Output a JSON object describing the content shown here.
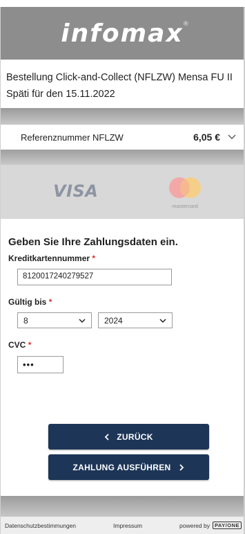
{
  "brand": {
    "logo": "infomax",
    "registered": "®"
  },
  "order": {
    "title": "Bestellung Click-and-Collect (NFLZW) Mensa FU II Späti für den 15.11.2022"
  },
  "reference": {
    "label": "Referenznummer NFLZW",
    "amount": "6,05 €"
  },
  "cards": {
    "visa": "VISA",
    "mastercard": "mastercard"
  },
  "form": {
    "title": "Geben Sie Ihre Zahlungsdaten ein.",
    "card_number_label": "Kreditkartennummer",
    "card_number_value": "8120017240279527",
    "valid_label": "Gültig bis",
    "month_value": "8",
    "year_value": "2024",
    "cvc_label": "CVC",
    "cvc_value": "•••",
    "required_mark": "*"
  },
  "buttons": {
    "back": "ZURÜCK",
    "pay": "ZAHLUNG AUSFÜHREN"
  },
  "footer": {
    "privacy": "Datenschutzbestimmungen",
    "imprint": "Impressum",
    "powered_by": "powered by",
    "payone": "PAY/ONE"
  },
  "colors": {
    "header": "#8d8d8d",
    "button": "#1d3557",
    "required": "#d9302c"
  }
}
